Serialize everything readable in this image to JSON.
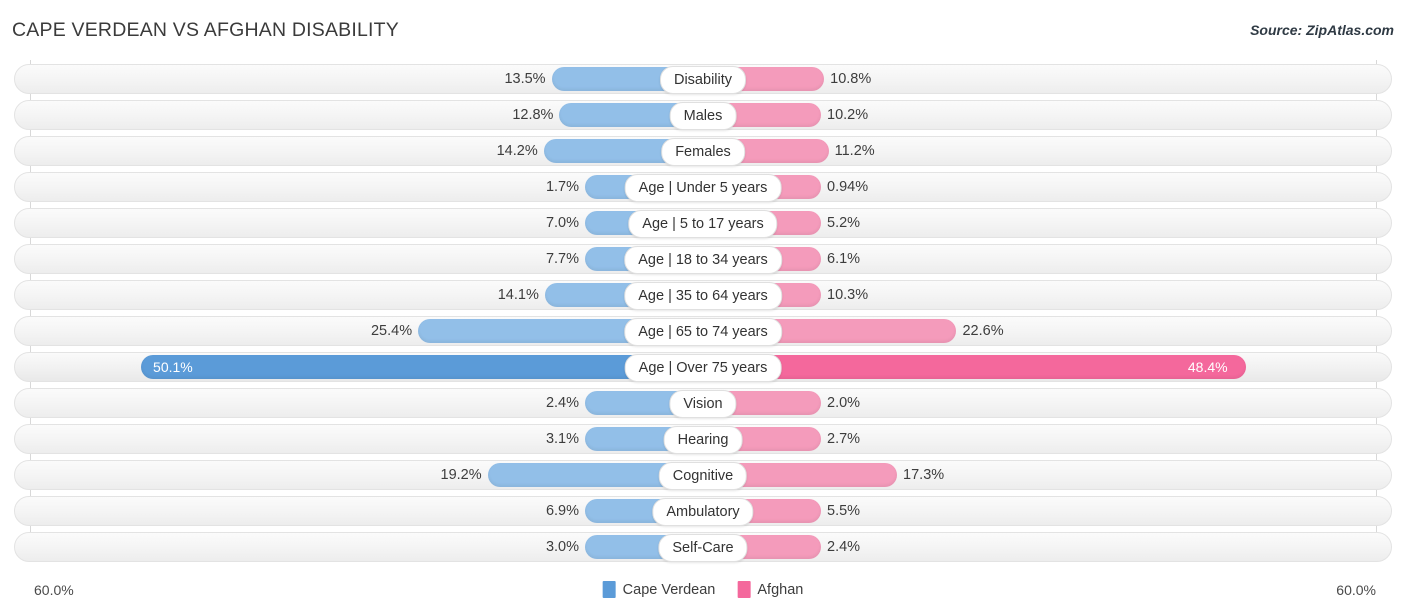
{
  "header": {
    "title": "CAPE VERDEAN VS AFGHAN DISABILITY",
    "source": "Source: ZipAtlas.com"
  },
  "footer": {
    "axis_left": "60.0%",
    "axis_right": "60.0%",
    "legend": [
      {
        "label": "Cape Verdean",
        "color": "#5b9bd8"
      },
      {
        "label": "Afghan",
        "color": "#f4689c"
      }
    ]
  },
  "colors": {
    "left_bar": "#92bfe8",
    "right_bar": "#f49bbb",
    "left_bar_highlight": "#5b9bd8",
    "right_bar_highlight": "#f4689c",
    "track": "#f4f4f4",
    "gridline": "#d8d8d8"
  },
  "chart_data": {
    "type": "bar",
    "orientation": "horizontal-diverging",
    "title": "CAPE VERDEAN VS AFGHAN DISABILITY",
    "xlabel": "",
    "ylabel": "",
    "axis_max_percent": 60.0,
    "xlim": [
      60.0,
      60.0
    ],
    "grid": true,
    "legend_position": "bottom-center",
    "categories": [
      "Disability",
      "Males",
      "Females",
      "Age | Under 5 years",
      "Age | 5 to 17 years",
      "Age | 18 to 34 years",
      "Age | 35 to 64 years",
      "Age | 65 to 74 years",
      "Age | Over 75 years",
      "Vision",
      "Hearing",
      "Cognitive",
      "Ambulatory",
      "Self-Care"
    ],
    "series": [
      {
        "name": "Cape Verdean",
        "color": "#5b9bd8",
        "values": [
          13.5,
          12.8,
          14.2,
          1.7,
          7.0,
          7.7,
          14.1,
          25.4,
          50.1,
          2.4,
          3.1,
          19.2,
          6.9,
          3.0
        ],
        "labels": [
          "13.5%",
          "12.8%",
          "14.2%",
          "1.7%",
          "7.0%",
          "7.7%",
          "14.1%",
          "25.4%",
          "50.1%",
          "2.4%",
          "3.1%",
          "19.2%",
          "6.9%",
          "3.0%"
        ]
      },
      {
        "name": "Afghan",
        "color": "#f4689c",
        "values": [
          10.8,
          10.2,
          11.2,
          0.94,
          5.2,
          6.1,
          10.3,
          22.6,
          48.4,
          2.0,
          2.7,
          17.3,
          5.5,
          2.4
        ],
        "labels": [
          "10.8%",
          "10.2%",
          "11.2%",
          "0.94%",
          "5.2%",
          "6.1%",
          "10.3%",
          "22.6%",
          "48.4%",
          "2.0%",
          "2.7%",
          "17.3%",
          "5.5%",
          "2.4%"
        ]
      }
    ],
    "highlighted_category": "Age | Over 75 years"
  }
}
